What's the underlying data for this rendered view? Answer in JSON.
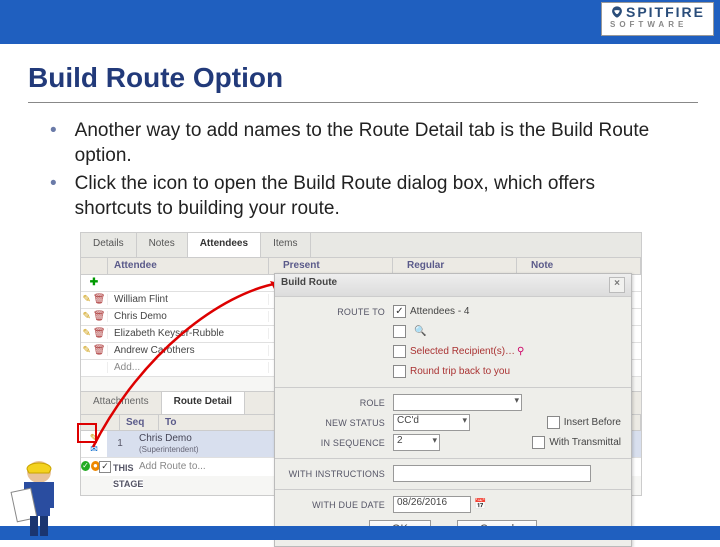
{
  "logo": {
    "top": "SPITFIRE",
    "sub": "SOFTWARE"
  },
  "title": "Build Route Option",
  "bullets": [
    "Another way to add names to the Route Detail tab is the Build Route option.",
    "Click the icon to open the Build Route dialog box, which offers shortcuts to building your route."
  ],
  "tabs": {
    "details": "Details",
    "notes": "Notes",
    "attendees": "Attendees",
    "items": "Items"
  },
  "gridhead": {
    "attendee": "Attendee",
    "present": "Present",
    "regular": "Regular",
    "note": "Note"
  },
  "attendees": [
    "William Flint",
    "Chris Demo",
    "Elizabeth Keyser-Rubble",
    "Andrew Carothers"
  ],
  "addrowtext": "Add...",
  "subtabs": {
    "attachments": "Attachments",
    "route": "Route Detail"
  },
  "routehead": {
    "seq": "Seq",
    "to": "To"
  },
  "route_row": {
    "seq": "1",
    "name": "Chris Demo",
    "role": "(Superintendent)"
  },
  "route_add": "Add Route to...",
  "thislabel": "THIS",
  "stagelabel": "STAGE",
  "dialog": {
    "title": "Build Route",
    "routeto_label": "Route To",
    "attendees_opt": "Attendees - 4",
    "selected_opt": "Selected Recipient(s)…",
    "roundtrip_opt": "Round trip back to you",
    "role_label": "Role",
    "newstatus_label": "New Status",
    "newstatus_val": "CC'd",
    "insequence_label": "In Sequence",
    "insequence_val": "2",
    "insertbefore": "Insert Before",
    "withtransmittal": "With Transmittal",
    "instructions_label": "With Instructions",
    "duedate_label": "With Due Date",
    "duedate_val": "08/26/2016",
    "ok": "OK",
    "cancel": "Cancel"
  }
}
